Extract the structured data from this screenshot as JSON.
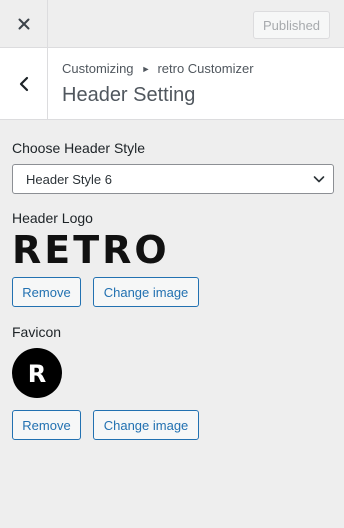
{
  "topbar": {
    "close_icon": "close-icon",
    "published_label": "Published"
  },
  "section": {
    "back_icon": "chevron-left-icon",
    "breadcrumb_root": "Customizing",
    "breadcrumb_child": "retro Customizer",
    "title": "Header Setting"
  },
  "header_style": {
    "label": "Choose Header Style",
    "selected": "Header Style 6"
  },
  "header_logo": {
    "label": "Header Logo",
    "logo_text": "RETRO",
    "remove_label": "Remove",
    "change_label": "Change image"
  },
  "favicon": {
    "label": "Favicon",
    "letter": "R",
    "remove_label": "Remove",
    "change_label": "Change image"
  },
  "colors": {
    "accent": "#2271b1",
    "background": "#eeeeee"
  }
}
